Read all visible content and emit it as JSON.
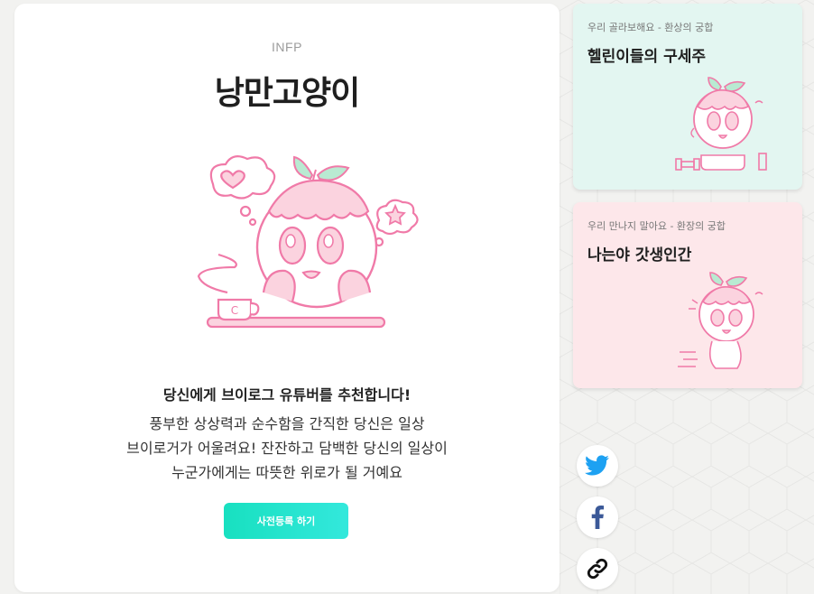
{
  "main": {
    "type_code": "INFP",
    "title": "낭만고양이",
    "recommendation": "당신에게 브이로그 유튜버를 추천합니다!",
    "description_lines": [
      "풍부한 상상력과 순수함을 간직한 당신은 일상",
      "브이로거가 어울려요! 잔잔하고 담백한 당신의 일상이",
      "누군가에게는 따뜻한 위로가 될 거예요"
    ],
    "cta_label": "사전등록 하기"
  },
  "side_cards": [
    {
      "subtitle": "우리 골라보해요 - 환상의 궁합",
      "title": "헬린이들의 구세주",
      "color": "#e3f6f1"
    },
    {
      "subtitle": "우리 만나지 말아요 - 환장의 궁합",
      "title": "나는야 갓생인간",
      "color": "#fde7ea"
    }
  ],
  "social": [
    {
      "icon": "twitter-icon",
      "color": "#1da1f2"
    },
    {
      "icon": "facebook-icon",
      "color": "#3b5998"
    },
    {
      "icon": "link-icon",
      "color": "#111111"
    }
  ],
  "colors": {
    "accent": "#1fe3c9",
    "character_line": "#f07aa8",
    "character_fill": "#fbd3df",
    "leaf": "#b9ead2"
  }
}
